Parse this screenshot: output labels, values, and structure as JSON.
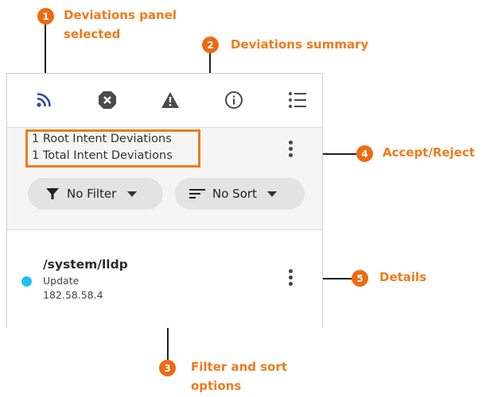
{
  "callouts": {
    "c1": {
      "number": "1",
      "line1": "Deviations panel",
      "line2": "selected"
    },
    "c2": {
      "number": "2",
      "text": "Deviations summary"
    },
    "c3": {
      "number": "3",
      "line1": "Filter and sort",
      "line2": "options"
    },
    "c4": {
      "number": "4",
      "text": "Accept/Reject"
    },
    "c5": {
      "number": "5",
      "text": "Details"
    }
  },
  "toolbar": {
    "icons": [
      "deviations-icon",
      "error-icon",
      "warning-icon",
      "info-icon",
      "list-icon"
    ],
    "active_color": "#2d4aa1"
  },
  "summary": {
    "root_deviations": "1 Root Intent Deviations",
    "total_deviations": "1 Total Intent Deviations"
  },
  "filter": {
    "label": "No Filter"
  },
  "sort": {
    "label": "No Sort"
  },
  "deviation_item": {
    "path": "/system/lldp",
    "action": "Update",
    "address": "182.58.58.4",
    "status_color": "#1ec0f0"
  },
  "colors": {
    "accent": "#f07a1c",
    "badge": "#ee6a12"
  }
}
